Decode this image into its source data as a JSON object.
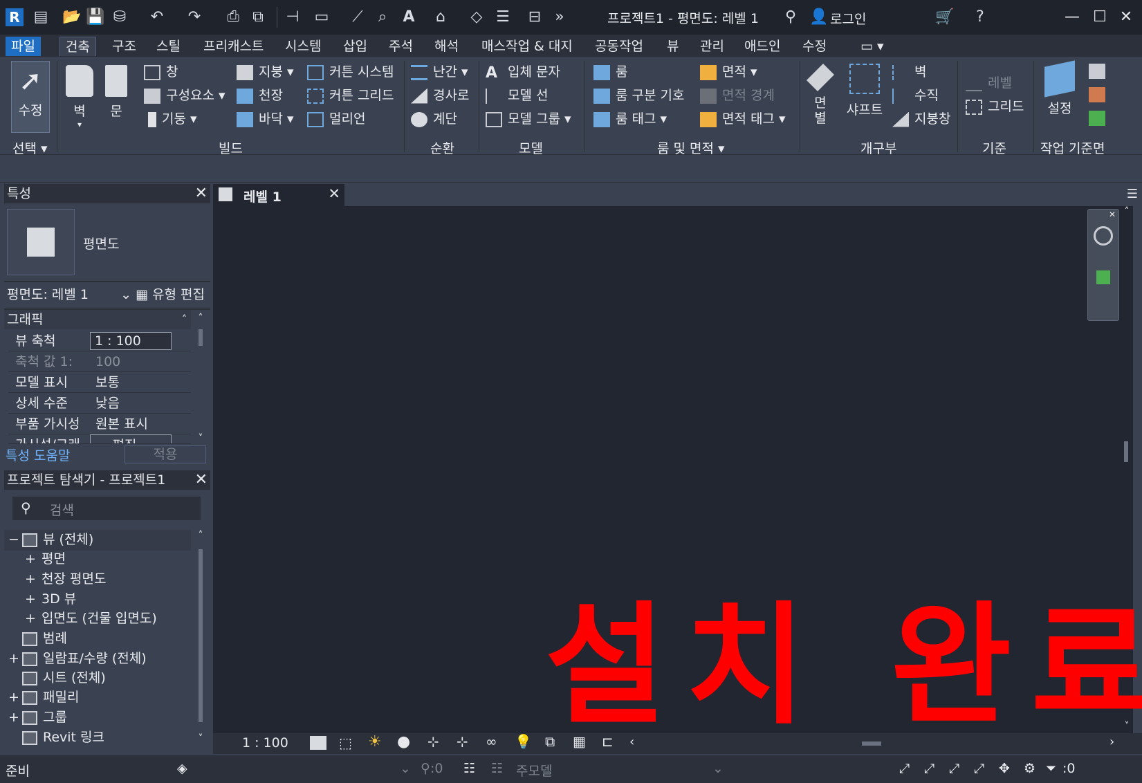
{
  "window": {
    "title": "프로젝트1 - 평면도: 레벨 1",
    "login": "로그인"
  },
  "menu": {
    "tabs": [
      "파일",
      "건축",
      "구조",
      "스틸",
      "프리캐스트",
      "시스템",
      "삽입",
      "주석",
      "해석",
      "매스작업 & 대지",
      "공동작업",
      "뷰",
      "관리",
      "애드인",
      "수정"
    ]
  },
  "ribbon": {
    "select": {
      "button": "수정",
      "label": "선택 ▾"
    },
    "build": {
      "label": "빌드",
      "wall": "벽",
      "door": "문",
      "items": [
        "창",
        "구성요소",
        "기둥",
        "지붕",
        "천장",
        "바닥",
        "커튼 시스템",
        "커튼 그리드",
        "멀리언"
      ]
    },
    "circulation": {
      "label": "순환",
      "items": [
        "난간",
        "경사로",
        "계단"
      ]
    },
    "model": {
      "label": "모델",
      "items": [
        "입체 문자",
        "모델 선",
        "모델 그룹"
      ]
    },
    "room_area": {
      "label": "룸 및 면적 ▾",
      "items": [
        "룸",
        "룸 구분 기호",
        "룸 태그",
        "면적",
        "면적 경계",
        "면적 태그"
      ]
    },
    "opening": {
      "label": "개구부",
      "face": "면\n별",
      "shaft": "샤프트",
      "items": [
        "벽",
        "수직",
        "지붕창"
      ]
    },
    "datum": {
      "label": "기준",
      "level": "레벨",
      "grid": "그리드"
    },
    "workplane": {
      "label": "작업 기준면",
      "set": "설정"
    }
  },
  "properties": {
    "title": "특성",
    "type_name": "평면도",
    "selector": "평면도: 레벨 1",
    "edit_type": "유형 편집",
    "group": "그래픽",
    "rows": [
      {
        "k": "뷰 축척",
        "v": "1 : 100"
      },
      {
        "k": "축척 값    1:",
        "v": "100"
      },
      {
        "k": "모델 표시",
        "v": "보통"
      },
      {
        "k": "상세 수준",
        "v": "낮음"
      },
      {
        "k": "부품 가시성",
        "v": "원본 표시"
      },
      {
        "k": "가시성/그래",
        "v": "편집..."
      }
    ],
    "help": "특성 도움말",
    "apply": "적용"
  },
  "browser": {
    "title": "프로젝트 탐색기 - 프로젝트1",
    "search_placeholder": "검색",
    "items": [
      {
        "label": "뷰 (전체)",
        "level": 0,
        "toggle": "−"
      },
      {
        "label": "평면",
        "level": 1,
        "toggle": "+"
      },
      {
        "label": "천장 평면도",
        "level": 1,
        "toggle": "+"
      },
      {
        "label": "3D 뷰",
        "level": 1,
        "toggle": "+"
      },
      {
        "label": "입면도 (건물 입면도)",
        "level": 1,
        "toggle": "+"
      },
      {
        "label": "범례",
        "level": 0,
        "toggle": ""
      },
      {
        "label": "일람표/수량 (전체)",
        "level": 0,
        "toggle": "+"
      },
      {
        "label": "시트 (전체)",
        "level": 0,
        "toggle": ""
      },
      {
        "label": "패밀리",
        "level": 0,
        "toggle": "+"
      },
      {
        "label": "그룹",
        "level": 0,
        "toggle": "+"
      },
      {
        "label": "Revit 링크",
        "level": 0,
        "toggle": ""
      }
    ]
  },
  "view": {
    "tab": "레벨 1",
    "overlay_text": "설치 완료",
    "scale": "1 : 100"
  },
  "status": {
    "text": "준비",
    "count": ":0",
    "model": "주모델",
    "filter": ":0"
  }
}
